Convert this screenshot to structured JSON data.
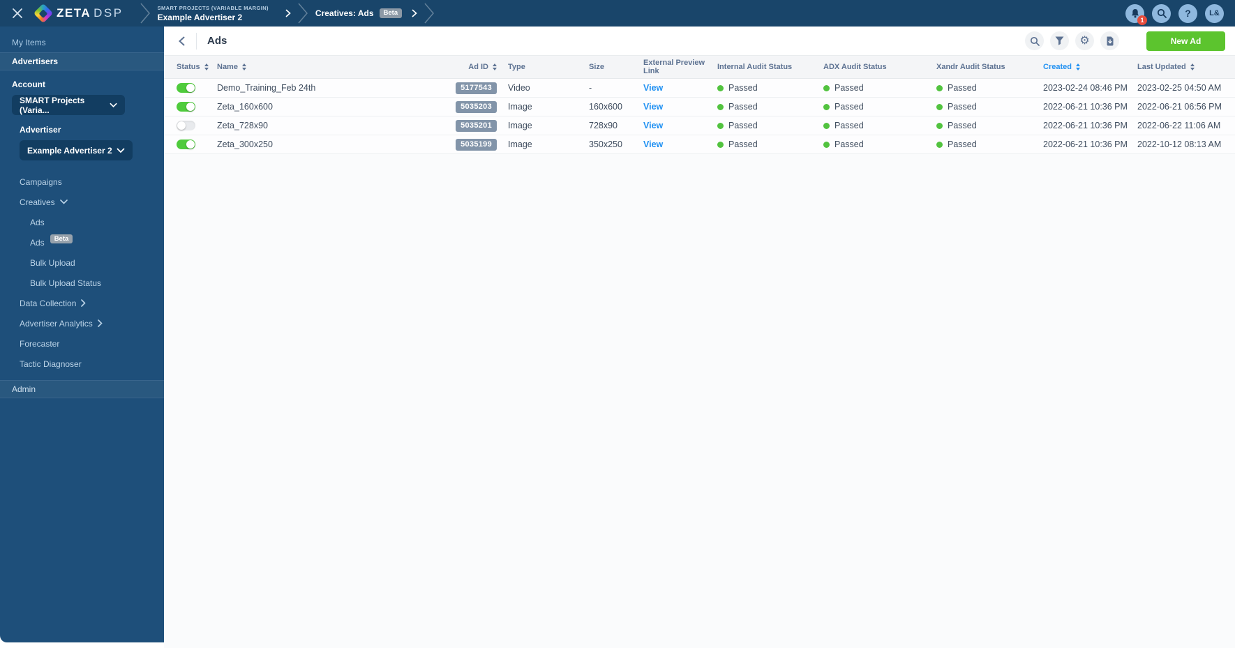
{
  "colors": {
    "topbar": "#19456a",
    "sidebar": "#1e4f7a",
    "accent_green": "#5cc42e",
    "toggle_on_green": "#4fcb3c",
    "passed_green": "#52c33f",
    "link_blue": "#2191f2",
    "badge_gray": "#8294a9",
    "notification_red": "#e74c3c"
  },
  "icons": {
    "gear_glyph": "⚙",
    "help_glyph": "?"
  },
  "topbar": {
    "brand": {
      "name": "ZETA",
      "suffix": "DSP"
    },
    "breadcrumbs": {
      "level1": {
        "eyebrow": "SMART PROJECTS (VARIABLE MARGIN)",
        "label": "Example Advertiser 2"
      },
      "level2": {
        "label": "Creatives: Ads",
        "badge": "Beta"
      }
    },
    "notifications": {
      "count": "1"
    },
    "avatar_initials": "L&"
  },
  "sidebar": {
    "my_items": "My Items",
    "advertisers": "Advertisers",
    "account": {
      "label": "Account",
      "value": "SMART Projects (Varia..."
    },
    "advertiser": {
      "label": "Advertiser",
      "value": "Example Advertiser 2"
    },
    "nav": {
      "campaigns": "Campaigns",
      "creatives": "Creatives",
      "creatives_children": [
        {
          "label": "Ads"
        },
        {
          "label": "Ads",
          "badge": "Beta"
        },
        {
          "label": "Bulk Upload"
        },
        {
          "label": "Bulk Upload Status"
        }
      ],
      "data_collection": "Data Collection",
      "advertiser_analytics": "Advertiser Analytics",
      "forecaster": "Forecaster",
      "tactic_diagnoser": "Tactic Diagnoser"
    },
    "admin": "Admin"
  },
  "page": {
    "title": "Ads",
    "new_ad_label": "New Ad"
  },
  "table": {
    "columns": [
      {
        "label": "Status",
        "sortable": true
      },
      {
        "label": "Name",
        "sortable": true
      },
      {
        "label": "Ad ID",
        "sortable": true
      },
      {
        "label": "Type",
        "sortable": false
      },
      {
        "label": "Size",
        "sortable": false
      },
      {
        "label": "External Preview Link",
        "sortable": false
      },
      {
        "label": "Internal Audit Status",
        "sortable": false
      },
      {
        "label": "ADX Audit Status",
        "sortable": false
      },
      {
        "label": "Xandr Audit Status",
        "sortable": false
      },
      {
        "label": "Created",
        "sortable": true,
        "active": true
      },
      {
        "label": "Last Updated",
        "sortable": true
      }
    ],
    "rows": [
      {
        "enabled": true,
        "name": "Demo_Training_Feb 24th",
        "ad_id": "5177543",
        "type": "Video",
        "size": "-",
        "preview_label": "View",
        "internal_audit": "Passed",
        "adx_audit": "Passed",
        "xandr_audit": "Passed",
        "created": "2023-02-24 08:46 PM",
        "updated": "2023-02-25 04:50 AM"
      },
      {
        "enabled": true,
        "name": "Zeta_160x600",
        "ad_id": "5035203",
        "type": "Image",
        "size": "160x600",
        "preview_label": "View",
        "internal_audit": "Passed",
        "adx_audit": "Passed",
        "xandr_audit": "Passed",
        "created": "2022-06-21 10:36 PM",
        "updated": "2022-06-21 06:56 PM"
      },
      {
        "enabled": false,
        "name": "Zeta_728x90",
        "ad_id": "5035201",
        "type": "Image",
        "size": "728x90",
        "preview_label": "View",
        "internal_audit": "Passed",
        "adx_audit": "Passed",
        "xandr_audit": "Passed",
        "created": "2022-06-21 10:36 PM",
        "updated": "2022-06-22 11:06 AM"
      },
      {
        "enabled": true,
        "name": "Zeta_300x250",
        "ad_id": "5035199",
        "type": "Image",
        "size": "350x250",
        "preview_label": "View",
        "internal_audit": "Passed",
        "adx_audit": "Passed",
        "xandr_audit": "Passed",
        "created": "2022-06-21 10:36 PM",
        "updated": "2022-10-12 08:13 AM"
      }
    ]
  }
}
